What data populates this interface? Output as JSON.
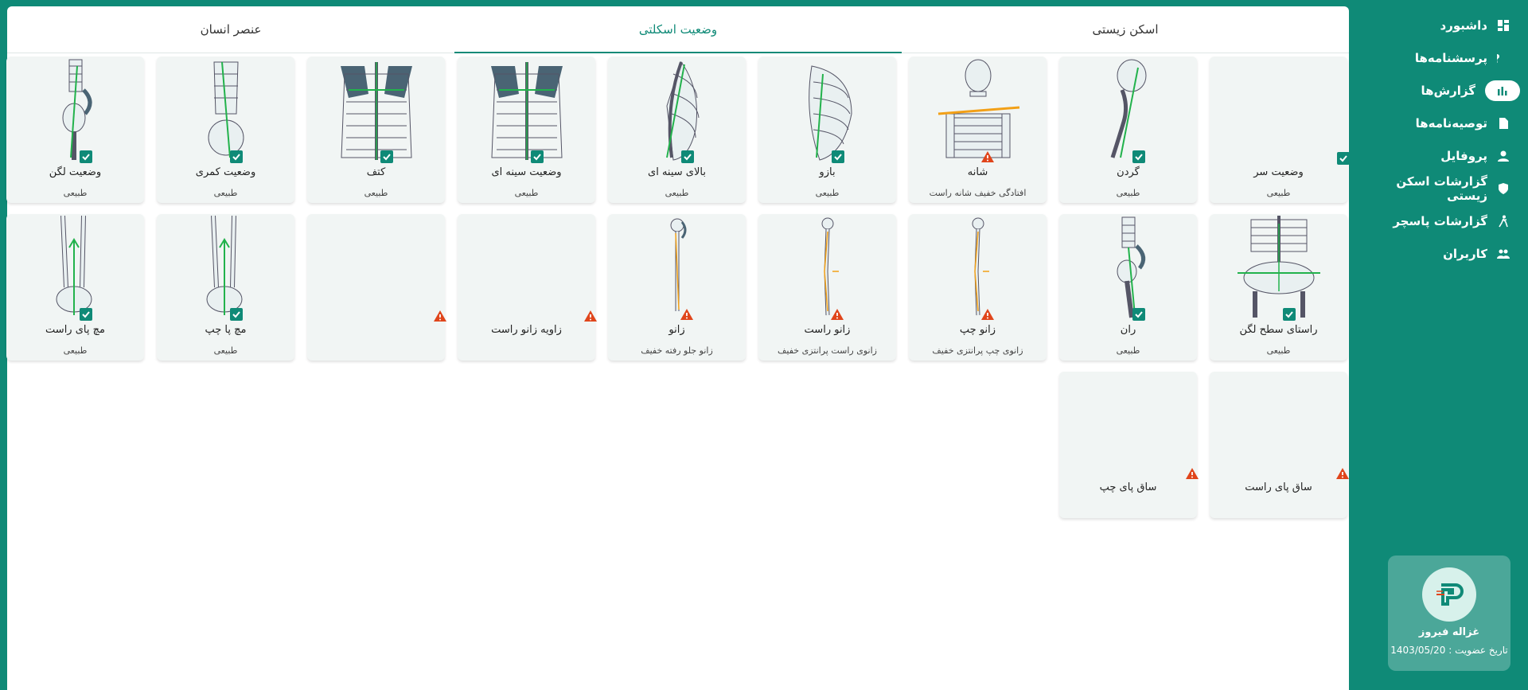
{
  "sidebar": {
    "items": [
      {
        "label": "داشبورد",
        "icon": "dashboard-icon"
      },
      {
        "label": "پرسشنامه‌ها",
        "icon": "question-icon"
      },
      {
        "label": "گزارش‌ها",
        "icon": "chart-icon",
        "active": true
      },
      {
        "label": "توصیه‌نامه‌ها",
        "icon": "document-icon"
      },
      {
        "label": "پروفایل",
        "icon": "person-icon"
      },
      {
        "label": "گزارشات اسکن زیستی",
        "icon": "shield-icon"
      },
      {
        "label": "گزارشات پاسچر",
        "icon": "posture-icon"
      },
      {
        "label": "کاربران",
        "icon": "users-icon"
      }
    ],
    "user": {
      "name": "غزاله فیروز",
      "date": "تاریخ عضویت : 1403/05/20"
    }
  },
  "tabs": [
    "اسکن زیستی",
    "وضعیت اسکلتی",
    "عنصر انسان"
  ],
  "cards": [
    {
      "title": "وضعیت سر",
      "status": "طبیعی",
      "flag": "ok",
      "figure": "none"
    },
    {
      "title": "گردن",
      "status": "طبیعی",
      "flag": "ok",
      "figure": "skull-side"
    },
    {
      "title": "شانه",
      "status": "افتادگی خفیف شانه راست",
      "flag": "warn",
      "figure": "skeleton-front"
    },
    {
      "title": "بازو",
      "status": "طبیعی",
      "flag": "ok",
      "figure": "ribs-side"
    },
    {
      "title": "بالای سینه ای",
      "status": "طبیعی",
      "flag": "ok",
      "figure": "spine-side"
    },
    {
      "title": "وضعیت سینه ای",
      "status": "طبیعی",
      "flag": "ok",
      "figure": "back"
    },
    {
      "title": "کتف",
      "status": "طبیعی",
      "flag": "ok",
      "figure": "back"
    },
    {
      "title": "وضعیت کمری",
      "status": "طبیعی",
      "flag": "ok",
      "figure": "lumbar"
    },
    {
      "title": "وضعیت لگن",
      "status": "طبیعی",
      "flag": "ok",
      "figure": "pelvis-side"
    },
    {
      "title": "راستای سطح لگن",
      "status": "طبیعی",
      "flag": "ok",
      "figure": "pelvis-front"
    },
    {
      "title": "ران",
      "status": "طبیعی",
      "flag": "ok",
      "figure": "thigh"
    },
    {
      "title": "زانو چپ",
      "status": "زانوی چپ پرانتزی خفیف",
      "flag": "warn",
      "figure": "leg"
    },
    {
      "title": "زانو راست",
      "status": "زانوی راست پرانتزی خفیف",
      "flag": "warn",
      "figure": "leg"
    },
    {
      "title": "زانو",
      "status": "زانو جلو رفته خفیف",
      "flag": "warn",
      "figure": "leg-side"
    },
    {
      "title": "زاویه زانو راست",
      "status": "",
      "flag": "warn",
      "figure": "none"
    },
    {
      "title": "",
      "status": "",
      "flag": "warn",
      "figure": "none"
    },
    {
      "title": "مچ پا چپ",
      "status": "طبیعی",
      "flag": "ok",
      "figure": "ankle"
    },
    {
      "title": "مچ پای راست",
      "status": "طبیعی",
      "flag": "ok",
      "figure": "ankle"
    },
    {
      "title": "ساق پای راست",
      "status": "",
      "flag": "warn",
      "figure": "none"
    },
    {
      "title": "ساق پای چپ",
      "status": "",
      "flag": "warn",
      "figure": "none"
    }
  ],
  "colors": {
    "accent": "#0f8a77",
    "warn": "#e0451b",
    "green_line": "#22b24c",
    "orange_line": "#f2a017",
    "bone": "#e9f0f1"
  }
}
